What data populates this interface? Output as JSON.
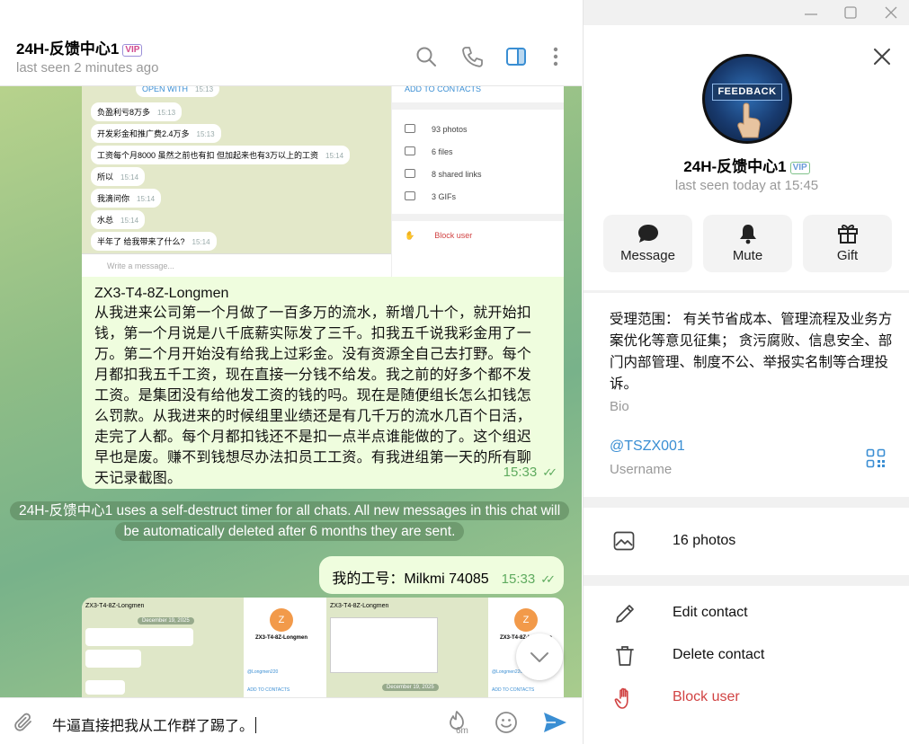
{
  "chat": {
    "title": "24H-反馈中心1",
    "vip_badge": "VIP",
    "status": "last seen 2 minutes ago"
  },
  "embedded_screenshot_1": {
    "top_label": "OPEN WITH",
    "top_time": "15:13",
    "messages": [
      {
        "text": "负盈利亏8万多",
        "time": "15:13"
      },
      {
        "text": "开发彩金和推广费2.4万多",
        "time": "15:13"
      },
      {
        "text": "工资每个月8000 虽然之前也有扣 但加起来也有3万以上的工资",
        "time": "15:14"
      },
      {
        "text": "所以",
        "time": "15:14"
      },
      {
        "text": "我滴问你",
        "time": "15:14"
      },
      {
        "text": "水总",
        "time": "15:14"
      },
      {
        "text": "半年了 给我带来了什么?",
        "time": "15:14"
      }
    ],
    "input_placeholder": "Write a message...",
    "side": {
      "add_contacts": "ADD TO CONTACTS",
      "rows": [
        "93 photos",
        "6 files",
        "8 shared links",
        "3 GIFs"
      ],
      "block": "Block user"
    }
  },
  "long_message": {
    "sender": "ZX3-T4-8Z-Longmen",
    "text": "从我进来公司第一个月做了一百多万的流水，新增几十个，就开始扣钱，第一个月说是八千底薪实际发了三千。扣我五千说我彩金用了一万。第二个月开始没有给我上过彩金。没有资源全自己去打野。每个月都扣我五千工资，现在直接一分钱不给发。我之前的好多个都不发工资。是集团没有给他发工资的钱的吗。现在是随便组长怎么扣钱怎么罚款。从我进来的时候组里业绩还是有几千万的流水几百个日活，走完了人都。每个月都扣钱还不是扣一点半点谁能做的了。这个组迟早也是废。赚不到钱想尽办法扣员工工资。有我进组第一天的所有聊天记录截图。",
    "time": "15:33"
  },
  "service_message": "24H-反馈中心1 uses a self-destruct timer for all chats. All new messages in this chat will be automatically deleted after 6 months they are sent.",
  "short_message": {
    "text": "我的工号：Milkmi  74085",
    "time": "15:33"
  },
  "embedded_screenshot_2": {
    "left_title": "ZX3-T4-8Z-Longmen",
    "left_date": "December 19, 2025",
    "left_profile_name": "ZX3-T4-8Z-Longmen",
    "left_username": "@Longmen220",
    "left_add": "ADD TO CONTACTS",
    "right_title": "ZX3-T4-8Z-Longmen",
    "right_date": "December 19, 2025",
    "right_profile_name": "ZX3-T4-8Z-Longmen",
    "right_username": "@Longmen220",
    "right_add": "ADD TO CONTACTS",
    "avatar_letter": "Z"
  },
  "compose": {
    "text": "牛逼直接把我从工作群了踢了。",
    "timer_label": "6m"
  },
  "profile": {
    "avatar_text": "FEEDBACK",
    "name": "24H-反馈中心1",
    "vip_badge": "VIP",
    "status": "last seen today at 15:45",
    "actions": [
      {
        "label": "Message",
        "icon": "message-icon"
      },
      {
        "label": "Mute",
        "icon": "bell-icon"
      },
      {
        "label": "Gift",
        "icon": "gift-icon"
      }
    ],
    "bio": "受理范围： 有关节省成本、管理流程及业务方案优化等意见征集； 贪污腐败、信息安全、部门内部管理、制度不公、举报实名制等合理投诉。",
    "bio_label": "Bio",
    "username": "@TSZX001",
    "username_label": "Username",
    "media": "16 photos",
    "manage": [
      {
        "label": "Edit contact",
        "icon": "pencil-icon"
      },
      {
        "label": "Delete contact",
        "icon": "trash-icon"
      },
      {
        "label": "Block user",
        "icon": "hand-icon"
      }
    ]
  },
  "colors": {
    "accent": "#3a8ed3",
    "bubble_out": "#effdde",
    "time_green": "#5fab5f",
    "danger": "#d14343",
    "send": "#3a8ed3"
  }
}
